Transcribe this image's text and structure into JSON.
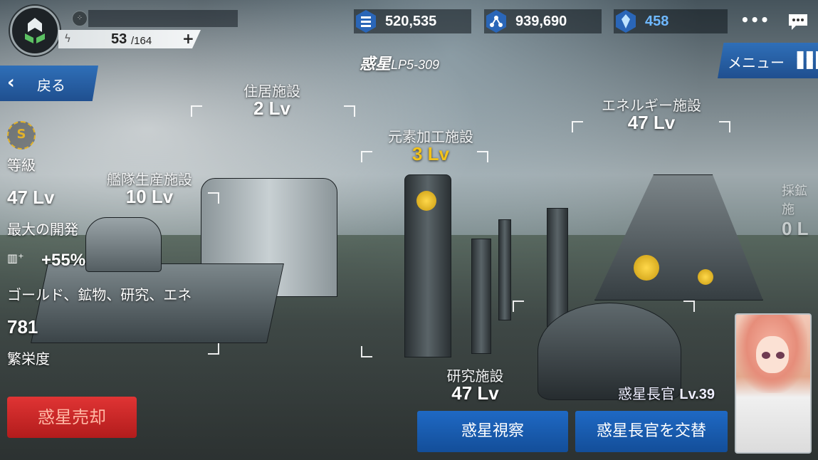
{
  "header": {
    "energy_current": "53",
    "energy_max": "/164",
    "energy_add": "+",
    "resources": [
      {
        "name": "gold",
        "icon": "gold-stack-icon",
        "value": "520,535",
        "color": "#ffffff"
      },
      {
        "name": "mineral",
        "icon": "mineral-molecule-icon",
        "value": "939,690",
        "color": "#ffffff"
      },
      {
        "name": "crystal",
        "icon": "crystal-icon",
        "value": "458",
        "color": "#6fb8ff"
      }
    ],
    "more_label": "•••",
    "menu_label": "メニュー",
    "back_label": "戻る"
  },
  "planet": {
    "title": "惑星",
    "code": "LP5-309"
  },
  "stats": {
    "rank_badge": "S",
    "grade_label": "等級",
    "grade_value": "47 Lv",
    "max_dev_label": "最大の開発",
    "bonus_value": "+55%",
    "bonus_desc": "ゴールド、鉱物、研究、エネ",
    "prosperity_value": "781",
    "prosperity_label": "繁栄度"
  },
  "facilities": [
    {
      "name": "住居施設",
      "level": "2 Lv",
      "highlight": false
    },
    {
      "name": "艦隊生産施設",
      "level": "10 Lv",
      "highlight": false
    },
    {
      "name": "元素加工施設",
      "level": "3 Lv",
      "highlight": true
    },
    {
      "name": "エネルギー施設",
      "level": "47 Lv",
      "highlight": false
    },
    {
      "name": "研究施設",
      "level": "47 Lv",
      "highlight": false
    },
    {
      "name": "採鉱施",
      "level": "0 L",
      "highlight": false
    }
  ],
  "governor": {
    "label": "惑星長官",
    "level": "Lv.39"
  },
  "buttons": {
    "sell": "惑星売却",
    "inspect": "惑星視察",
    "replace_governor": "惑星長官を交替"
  },
  "colors": {
    "button_blue": "#1f69c4",
    "sell_red": "#d22a2a",
    "highlight_yellow": "#f2c21a"
  }
}
